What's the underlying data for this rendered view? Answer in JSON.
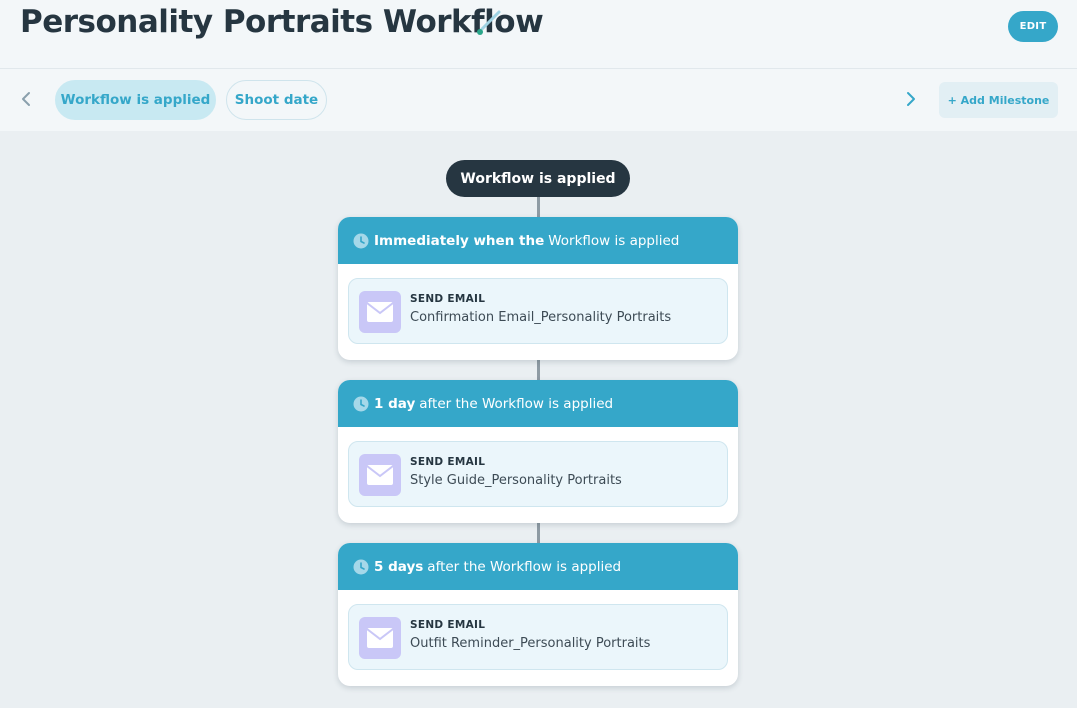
{
  "header": {
    "title": "Personality Portraits Workflow",
    "edit_label": "EDIT",
    "pencil_icon": "pencil-icon"
  },
  "milestones": {
    "prev_icon": "chevron-left-icon",
    "next_icon": "chevron-right-icon",
    "tabs": [
      {
        "label": "Workflow is applied",
        "active": true
      },
      {
        "label": "Shoot date",
        "active": false
      }
    ],
    "add_label": "+ Add Milestone"
  },
  "trigger": {
    "label": "Workflow is applied"
  },
  "steps": [
    {
      "timing_bold": "Immediately when the",
      "timing_rest": "Workflow is applied",
      "action_type": "SEND EMAIL",
      "action_name": "Confirmation Email_Personality Portraits"
    },
    {
      "timing_bold": "1 day",
      "timing_rest": "after the Workflow is applied",
      "action_type": "SEND EMAIL",
      "action_name": "Style Guide_Personality Portraits"
    },
    {
      "timing_bold": "5 days",
      "timing_rest": "after the Workflow is applied",
      "action_type": "SEND EMAIL",
      "action_name": "Outfit Reminder_Personality Portraits"
    }
  ],
  "colors": {
    "accent": "#35a7c9",
    "dark": "#263641",
    "action_bg": "#ebf6fb",
    "mail_icon_bg": "#c9c7f7"
  }
}
